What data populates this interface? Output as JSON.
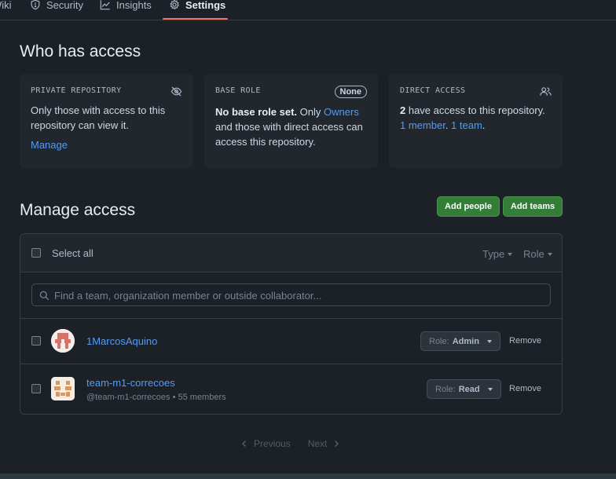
{
  "nav": {
    "tabs": [
      {
        "label": "Wiki",
        "icon": "book-icon"
      },
      {
        "label": "Security",
        "icon": "shield-icon"
      },
      {
        "label": "Insights",
        "icon": "graph-icon"
      },
      {
        "label": "Settings",
        "icon": "gear-icon"
      }
    ],
    "active_tab": "Settings",
    "accent": "#ec775c"
  },
  "who_has_access": {
    "title": "Who has access",
    "private_card": {
      "title": "PRIVATE REPOSITORY",
      "body": "Only those with access to this repository can view it.",
      "link": "Manage",
      "icon": "eye-closed-icon"
    },
    "base_role_card": {
      "title": "BASE ROLE",
      "badge": "None",
      "bold": "No base role set.",
      "text_a": " Only ",
      "link": "Owners",
      "text_b": " and those with direct access can access this repository."
    },
    "direct_card": {
      "title": "DIRECT ACCESS",
      "icon": "people-icon",
      "bold": "2",
      "text_a": " have access to this repository. ",
      "link_member": "1 member",
      "text_b": ". ",
      "link_team": "1 team",
      "text_c": "."
    }
  },
  "manage_access": {
    "title": "Manage access",
    "add_people": "Add people",
    "add_teams": "Add teams",
    "select_all": "Select all",
    "type_filter": "Type",
    "role_filter": "Role",
    "search_placeholder": "Find a team, organization member or outside collaborator...",
    "rows": [
      {
        "name": "1MarcosAquino",
        "sub": "",
        "role_prefix": "Role:",
        "role": "Admin",
        "remove": "Remove",
        "kind": "user"
      },
      {
        "name": "team-m1-correcoes",
        "sub": "@team-m1-correcoes • 55 members",
        "role_prefix": "Role:",
        "role": "Read",
        "remove": "Remove",
        "kind": "team"
      }
    ]
  },
  "pagination": {
    "previous": "Previous",
    "next": "Next"
  },
  "colors": {
    "link": "#539bf5",
    "green_button": "#347d39",
    "background": "#1c2128"
  }
}
